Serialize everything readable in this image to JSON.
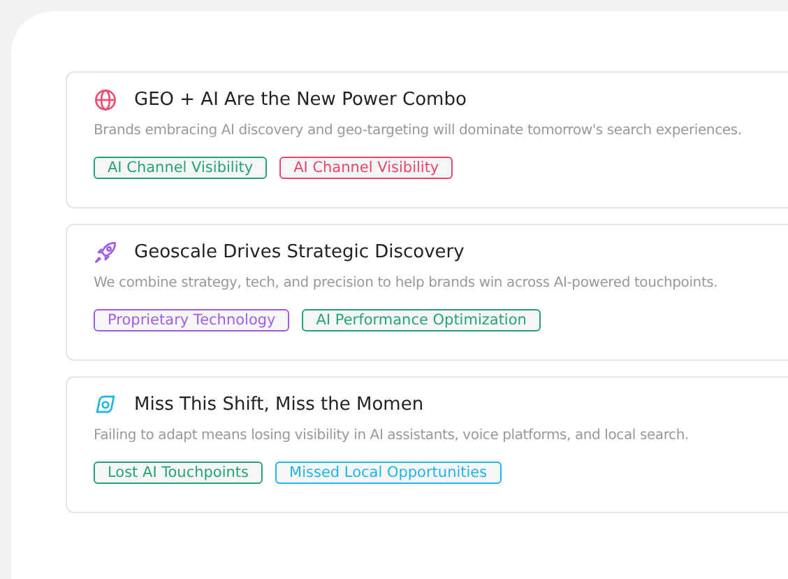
{
  "cards": [
    {
      "kind": "globe",
      "color": "#ee4f6e",
      "title": "GEO + AI Are the New Power Combo",
      "description": "Brands embracing AI discovery and geo-targeting will dominate tomorrow's search experiences.",
      "tags": [
        {
          "label": "AI Channel Visibility",
          "color": "#22a37a"
        },
        {
          "label": "AI Channel Visibility",
          "color": "#e8456b"
        }
      ]
    },
    {
      "kind": "rocket",
      "color": "#a25ce8",
      "title": "Geoscale Drives Strategic Discovery",
      "description": "We combine strategy, tech, and precision to help brands win across AI-powered touchpoints.",
      "tags": [
        {
          "label": "Proprietary Technology",
          "color": "#a25ce8"
        },
        {
          "label": "AI Performance Optimization",
          "color": "#22a37a"
        }
      ]
    },
    {
      "kind": "lens",
      "color": "#1fb5e6",
      "title": "Miss This Shift, Miss the Momen",
      "description": "Failing to adapt means losing visibility in AI assistants, voice platforms, and local search.",
      "tags": [
        {
          "label": "Lost AI Touchpoints",
          "color": "#22a37a"
        },
        {
          "label": "Missed Local Opportunities",
          "color": "#1fb5e6"
        }
      ]
    }
  ]
}
